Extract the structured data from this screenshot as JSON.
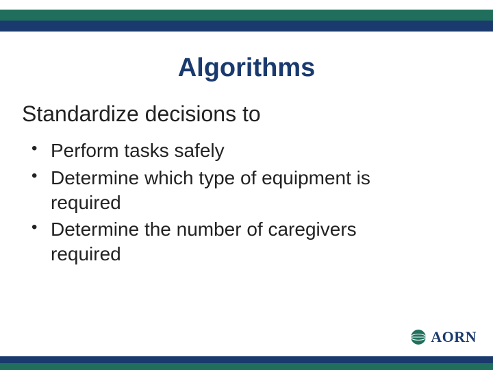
{
  "title": "Algorithms",
  "subtitle": "Standardize decisions to",
  "bullets": [
    "Perform tasks safely",
    "Determine which type of equipment is required",
    "Determine the number of caregivers required"
  ],
  "logo_text": "AORN"
}
